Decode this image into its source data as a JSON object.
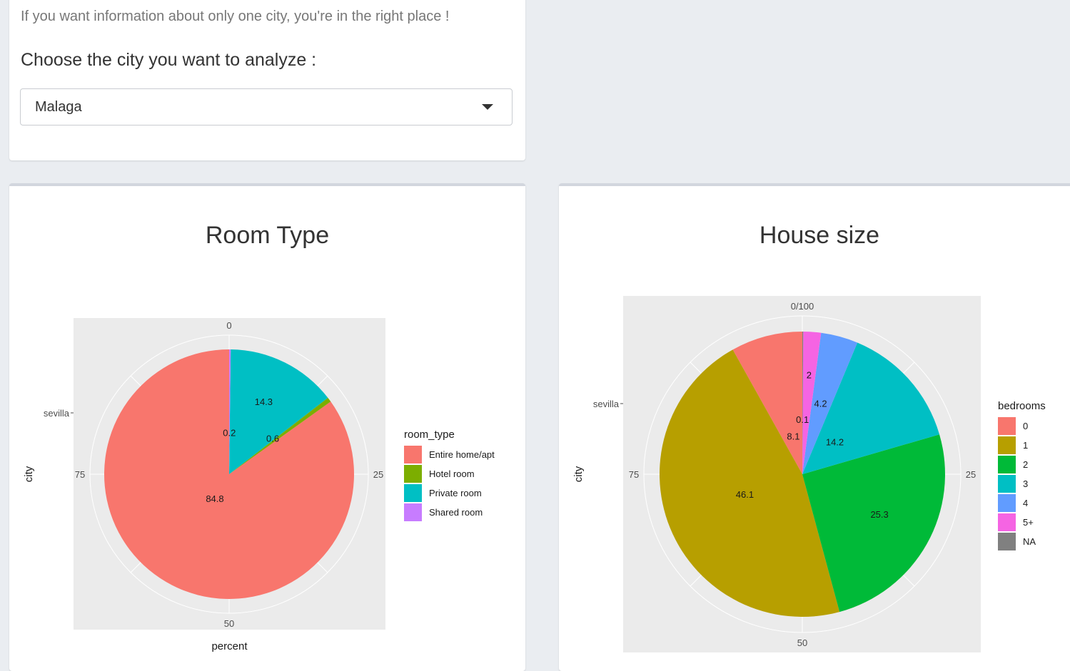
{
  "intro_text": "If you want information about only one city, you're in the right place !",
  "select_label": "Choose the city you want to analyze :",
  "city_select": {
    "value": "Malaga"
  },
  "charts_titles": {
    "room": "Room Type",
    "house": "House size"
  },
  "chart_data": [
    {
      "type": "pie",
      "title": "Room Type",
      "xlabel": "percent",
      "ylabel": "city",
      "y_tick": "sevilla",
      "theta_ticks": [
        "0",
        "25",
        "50",
        "75"
      ],
      "legend_title": "room_type",
      "legend_position": "right",
      "slices": [
        {
          "name": "Entire home/apt",
          "value": 84.8,
          "color": "#f8766d"
        },
        {
          "name": "Hotel room",
          "value": 0.6,
          "color": "#7cae00"
        },
        {
          "name": "Private room",
          "value": 14.3,
          "color": "#00bfc4"
        },
        {
          "name": "Shared room",
          "value": 0.2,
          "color": "#c77cff"
        }
      ]
    },
    {
      "type": "pie",
      "title": "House size",
      "xlabel": "",
      "ylabel": "city",
      "y_tick": "sevilla",
      "theta_ticks": [
        "0/100",
        "25",
        "50",
        "75"
      ],
      "legend_title": "bedrooms",
      "legend_position": "right",
      "slices": [
        {
          "name": "0",
          "value": 8.1,
          "color": "#f8766d"
        },
        {
          "name": "1",
          "value": 46.1,
          "color": "#b79f00"
        },
        {
          "name": "2",
          "value": 25.3,
          "color": "#00ba38"
        },
        {
          "name": "3",
          "value": 14.2,
          "color": "#00bfc4"
        },
        {
          "name": "4",
          "value": 4.2,
          "color": "#619cff"
        },
        {
          "name": "5+",
          "value": 2,
          "color": "#f564e3"
        },
        {
          "name": "NA",
          "value": 0.1,
          "color": "#808080"
        }
      ]
    }
  ]
}
